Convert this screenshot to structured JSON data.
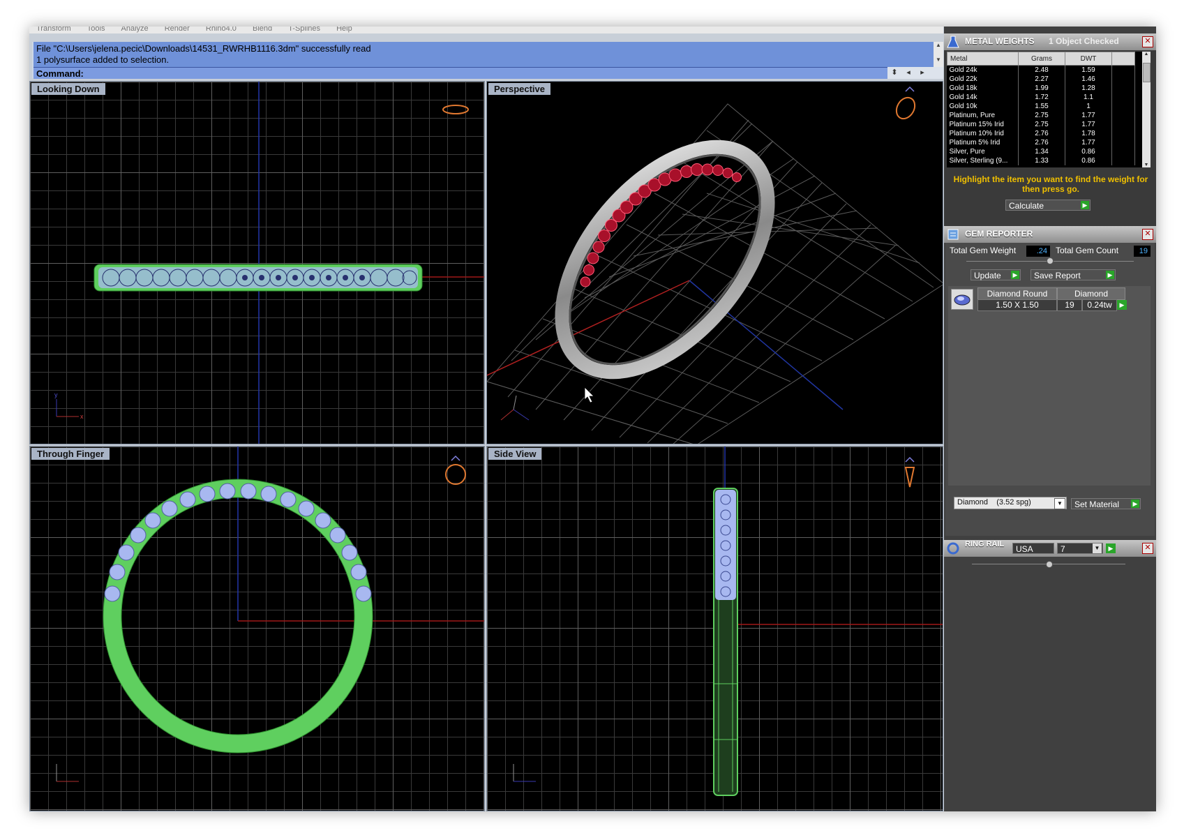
{
  "menu": [
    "Transform",
    "Tools",
    "Analyze",
    "Render",
    "Rhino4.0",
    "Blend",
    "T-Splines",
    "Help"
  ],
  "command": {
    "history": [
      "File \"C:\\Users\\jelena.pecic\\Downloads\\14531_RWRHB1116.3dm\" successfully read",
      "1 polysurface added to selection."
    ],
    "prompt": "Command:"
  },
  "viewports": {
    "top_left": "Looking Down",
    "top_right": "Perspective",
    "bottom_left": "Through Finger",
    "bottom_right": "Side View"
  },
  "metal_weights": {
    "title": "METAL WEIGHTS",
    "status": "1 Object Checked",
    "columns": [
      "Metal",
      "Grams",
      "DWT"
    ],
    "rows": [
      [
        "Gold 24k",
        "2.48",
        "1.59"
      ],
      [
        "Gold 22k",
        "2.27",
        "1.46"
      ],
      [
        "Gold 18k",
        "1.99",
        "1.28"
      ],
      [
        "Gold 14k",
        "1.72",
        "1.1"
      ],
      [
        "Gold 10k",
        "1.55",
        "1"
      ],
      [
        "Platinum, Pure",
        "2.75",
        "1.77"
      ],
      [
        "Platinum 15% Irid",
        "2.75",
        "1.77"
      ],
      [
        "Platinum 10% Irid",
        "2.76",
        "1.78"
      ],
      [
        "Platinum 5% Irid",
        "2.76",
        "1.77"
      ],
      [
        "Silver, Pure",
        "1.34",
        "0.86"
      ],
      [
        "Silver, Sterling (9...",
        "1.33",
        "0.86"
      ]
    ],
    "hint": "Highlight the item you want to find the weight for then press go.",
    "calculate_label": "Calculate"
  },
  "gem_reporter": {
    "title": "GEM REPORTER",
    "total_weight_label": "Total Gem Weight",
    "total_weight": ".24",
    "total_count_label": "Total Gem Count",
    "total_count": "19",
    "update_label": "Update",
    "save_label": "Save Report",
    "gem": {
      "shape": "Diamond Round",
      "type": "Diamond",
      "size": "1.50 X 1.50",
      "count": "19",
      "weight": "0.24tw"
    },
    "material": "Diamond    (3.52 spg)",
    "set_material_label": "Set Material"
  },
  "ring_rail": {
    "title": "RING RAIL",
    "standard": "USA",
    "size": "7"
  },
  "colors": {
    "history_bg": "#6f91d9",
    "viewport_label_bg": "#a9b4c6",
    "ring_green": "#5fcf5f",
    "gem_blue": "#a8b8f0",
    "ruby": "#b0102a",
    "hint_text": "#f0c000"
  }
}
